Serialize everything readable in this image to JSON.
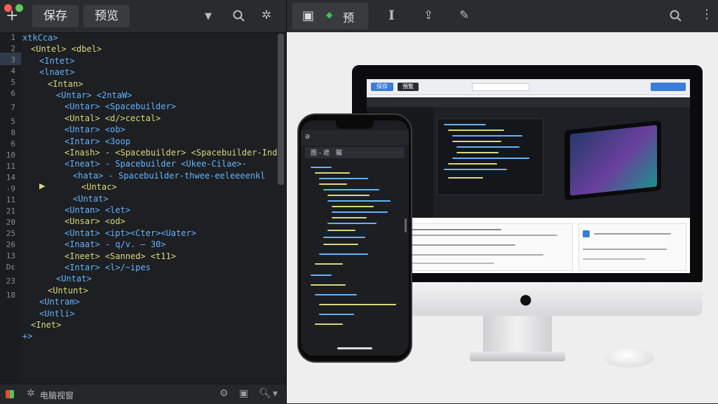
{
  "editor": {
    "toolbar": {
      "save_label": "保存",
      "preview_label": "预览"
    },
    "line_numbers": [
      "1",
      "2",
      "3",
      "4",
      "5",
      "6",
      "7",
      "5",
      "8",
      "6",
      "10",
      "11",
      "14",
      "-9",
      "11",
      "21",
      "20",
      "25",
      "26",
      "13",
      "Dε",
      "23",
      "18"
    ],
    "code_lines": [
      {
        "text": "xtkCca>",
        "indent": 0
      },
      {
        "text": "<Untel> <dbel>",
        "indent": 1
      },
      {
        "text": "<Intet>",
        "indent": 2
      },
      {
        "text": "<lnaet>",
        "indent": 2
      },
      {
        "text": "<Intan>",
        "indent": 3
      },
      {
        "text": "<Untar> <2ntaW>",
        "indent": 4
      },
      {
        "text": "<Untar> <Spacebuilder>",
        "indent": 5
      },
      {
        "text": "<Untal> <d/>cectal>",
        "indent": 5
      },
      {
        "text": "<Untar> <ob>",
        "indent": 5
      },
      {
        "text": "<Intar> <3oop",
        "indent": 5
      },
      {
        "text": "<Inash> - <Spacebuilder> <Spacebuilder-Ind",
        "indent": 5
      },
      {
        "text": "<Ineat> - Spacebuilder <Ukee-Cilae>-",
        "indent": 5
      },
      {
        "text": "<hata> - Spacebuilder-thwee-eeleeeenkl",
        "indent": 6
      },
      {
        "text": "<Untac>",
        "indent": 7
      },
      {
        "text": "<Untat>",
        "indent": 6
      },
      {
        "text": "<Untan> <let>",
        "indent": 5
      },
      {
        "text": "<Unsar> <od>",
        "indent": 5
      },
      {
        "text": "<Untat> <ipt><Cter><Uater>",
        "indent": 5
      },
      {
        "text": "<Inaat> - q/v. — 30>",
        "indent": 5
      },
      {
        "text": "<Ineet> <Sanned> <t11>",
        "indent": 5
      },
      {
        "text": "<Intar> <l>/~ipes",
        "indent": 5
      },
      {
        "text": "<Untat>",
        "indent": 4
      },
      {
        "text": "<Untunt>",
        "indent": 3
      },
      {
        "text": "<Untram>",
        "indent": 2
      },
      {
        "text": "<Untli>",
        "indent": 2
      },
      {
        "text": "<Inet>",
        "indent": 1
      },
      {
        "text": "+>",
        "indent": 0
      }
    ],
    "status_text": "电脑视窗"
  },
  "preview": {
    "toolbar_text": "预",
    "phone_labels": [
      "ǝ",
      "图 - 遮",
      "鬮"
    ],
    "monitor_tabs": [
      "保存",
      "預覧"
    ]
  },
  "colors": {
    "accent": "#3b7dd8",
    "code_tag": "#62b3ff",
    "code_attr": "#d7d97a"
  }
}
